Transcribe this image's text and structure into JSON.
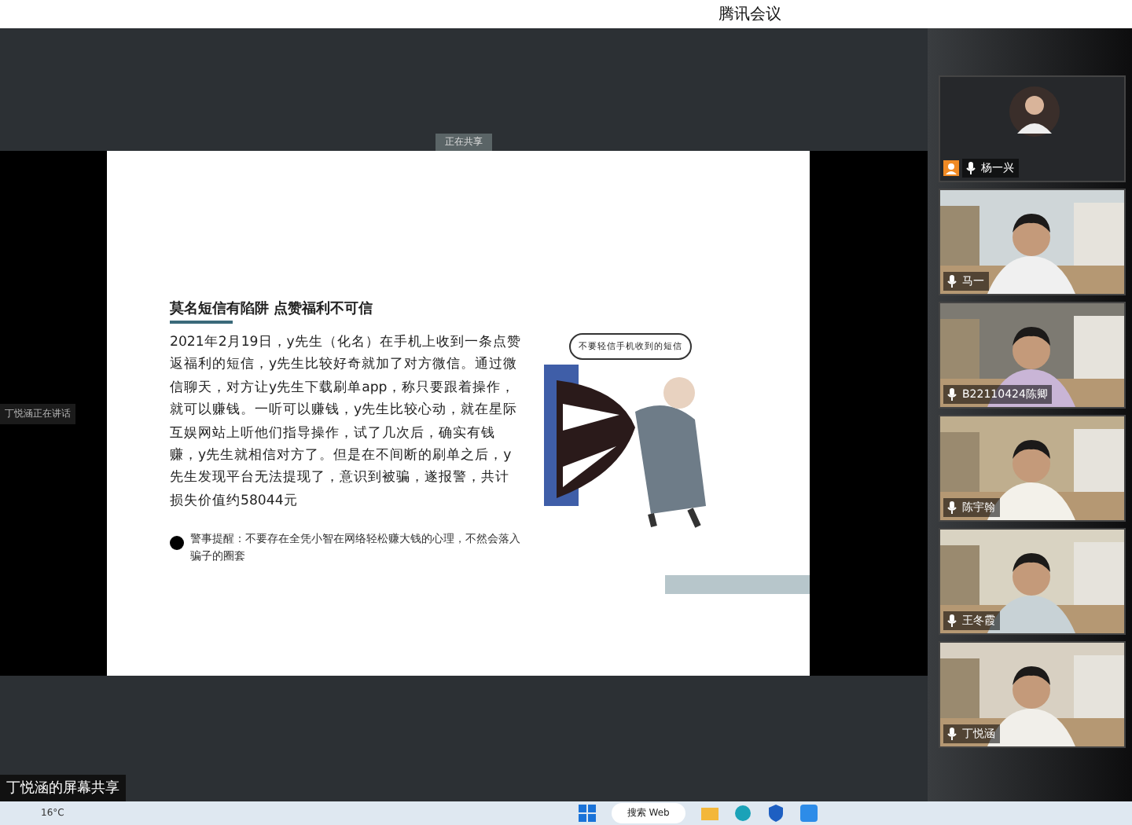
{
  "window": {
    "title": "腾讯会议"
  },
  "share": {
    "top_label": "正在共享",
    "speaker": "丁悦涵正在讲话",
    "footer": "丁悦涵的屏幕共享"
  },
  "slide": {
    "heading": "莫名短信有陷阱 点赞福利不可信",
    "body": "2021年2月19日，y先生（化名）在手机上收到一条点赞返福利的短信，y先生比较好奇就加了对方微信。通过微信聊天，对方让y先生下载刷单app，称只要跟着操作，就可以赚钱。一听可以赚钱，y先生比较心动，就在星际互娱网站上听他们指导操作，试了几次后，确实有钱赚，y先生就相信对方了。但是在不间断的刷单之后，y先生发现平台无法提现了，意识到被骗，遂报警，共计损失价值约58044元",
    "note": "警事提醒：不要存在全凭小智在网络轻松赚大钱的心理，不然会落入骗子的圈套",
    "bubble": "不要轻信手机收到的短信"
  },
  "participants": [
    {
      "name": "杨一兴",
      "kind": "avatar"
    },
    {
      "name": "马一",
      "kind": "video"
    },
    {
      "name": "B22110424陈卿",
      "kind": "video"
    },
    {
      "name": "陈宇翰",
      "kind": "video"
    },
    {
      "name": "王冬霞",
      "kind": "video"
    },
    {
      "name": "丁悦涵",
      "kind": "video"
    }
  ],
  "taskbar": {
    "weather": "16°C",
    "search": "搜索 Web"
  }
}
